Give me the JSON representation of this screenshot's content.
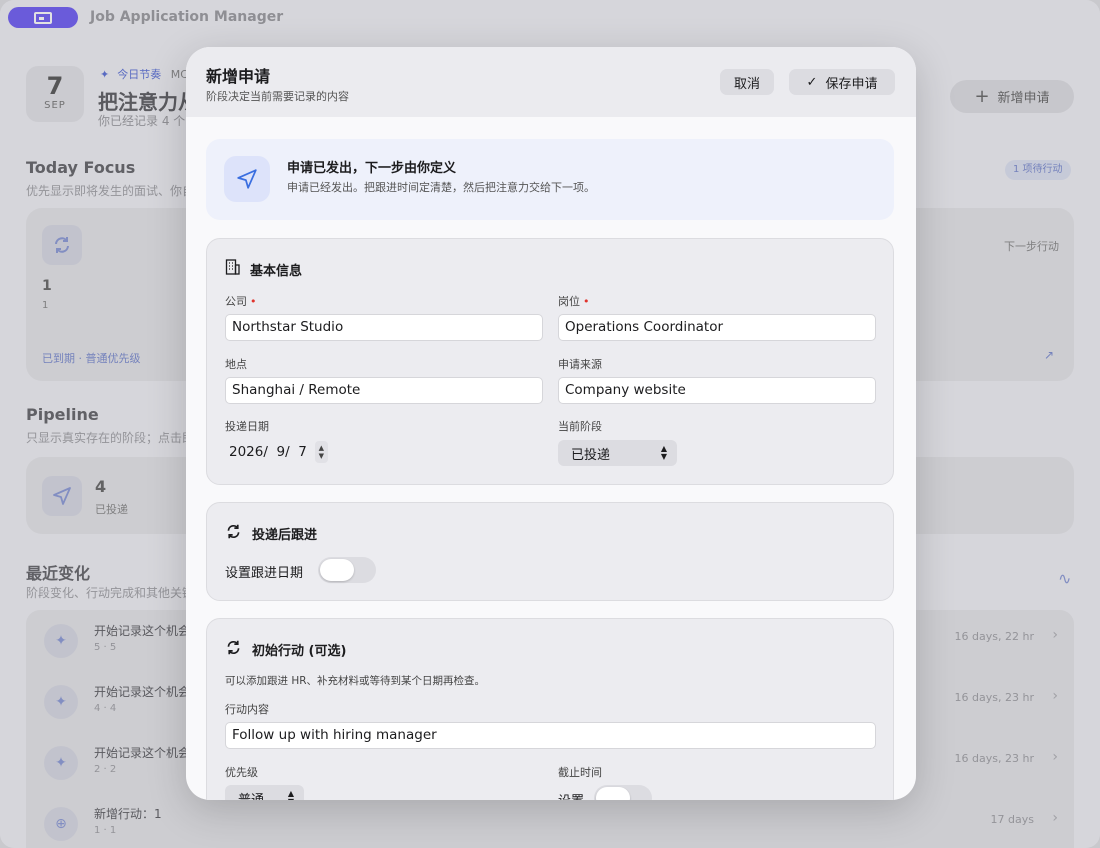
{
  "app": {
    "title": "Job Application Manager"
  },
  "background": {
    "date_day": "7",
    "date_month": "SEP",
    "rhythm_label": "今日节奏",
    "rhythm_extra": "MC",
    "headline": "把注意力从",
    "subline": "你已经记录 4 个",
    "new_button": "新增申请",
    "today_focus": {
      "title": "Today Focus",
      "sub": "优先显示即将发生的面试、你自",
      "badge": "1 项待行动",
      "next_step": "下一步行动",
      "count": "1",
      "count_sub": "1",
      "footer": "已到期 · 普通优先级"
    },
    "pipeline": {
      "title": "Pipeline",
      "sub": "只显示真实存在的阶段；点击即",
      "count": "4",
      "stage": "已投递"
    },
    "recent": {
      "title": "最近变化",
      "sub": "阶段变化、行动完成和其他关键",
      "items": [
        {
          "title": "开始记录这个机会",
          "meta": "5 · 5",
          "ago": "16 days, 22 hr"
        },
        {
          "title": "开始记录这个机会",
          "meta": "4 · 4",
          "ago": "16 days, 23 hr"
        },
        {
          "title": "开始记录这个机会",
          "meta": "2 · 2",
          "ago": "16 days, 23 hr"
        },
        {
          "title": "新增行动：1",
          "meta": "1 · 1",
          "ago": "17 days"
        }
      ]
    }
  },
  "modal": {
    "title": "新增申请",
    "subtitle": "阶段决定当前需要记录的内容",
    "cancel": "取消",
    "save": "保存申请",
    "notice": {
      "title": "申请已发出，下一步由你定义",
      "text": "申请已经发出。把跟进时间定清楚，然后把注意力交给下一项。"
    },
    "basic": {
      "title": "基本信息",
      "company_label": "公司",
      "company_value": "Northstar Studio",
      "position_label": "岗位",
      "position_value": "Operations Coordinator",
      "location_label": "地点",
      "location_value": "Shanghai / Remote",
      "source_label": "申请来源",
      "source_value": "Company website",
      "date_label": "投递日期",
      "date_value": "2026/  9/  7",
      "stage_label": "当前阶段",
      "stage_value": "已投递"
    },
    "followup": {
      "title": "投递后跟进",
      "toggle_label": "设置跟进日期"
    },
    "action": {
      "title": "初始行动 (可选)",
      "hint": "可以添加跟进 HR、补充材料或等待到某个日期再检查。",
      "content_label": "行动内容",
      "content_value": "Follow up with hiring manager",
      "priority_label": "优先级",
      "priority_value": "普通",
      "deadline_label": "截止时间",
      "deadline_toggle_label": "设置"
    }
  },
  "colors": {
    "accent": "#6e5cf6",
    "link": "#3b6fe0",
    "required": "#e0342d"
  }
}
